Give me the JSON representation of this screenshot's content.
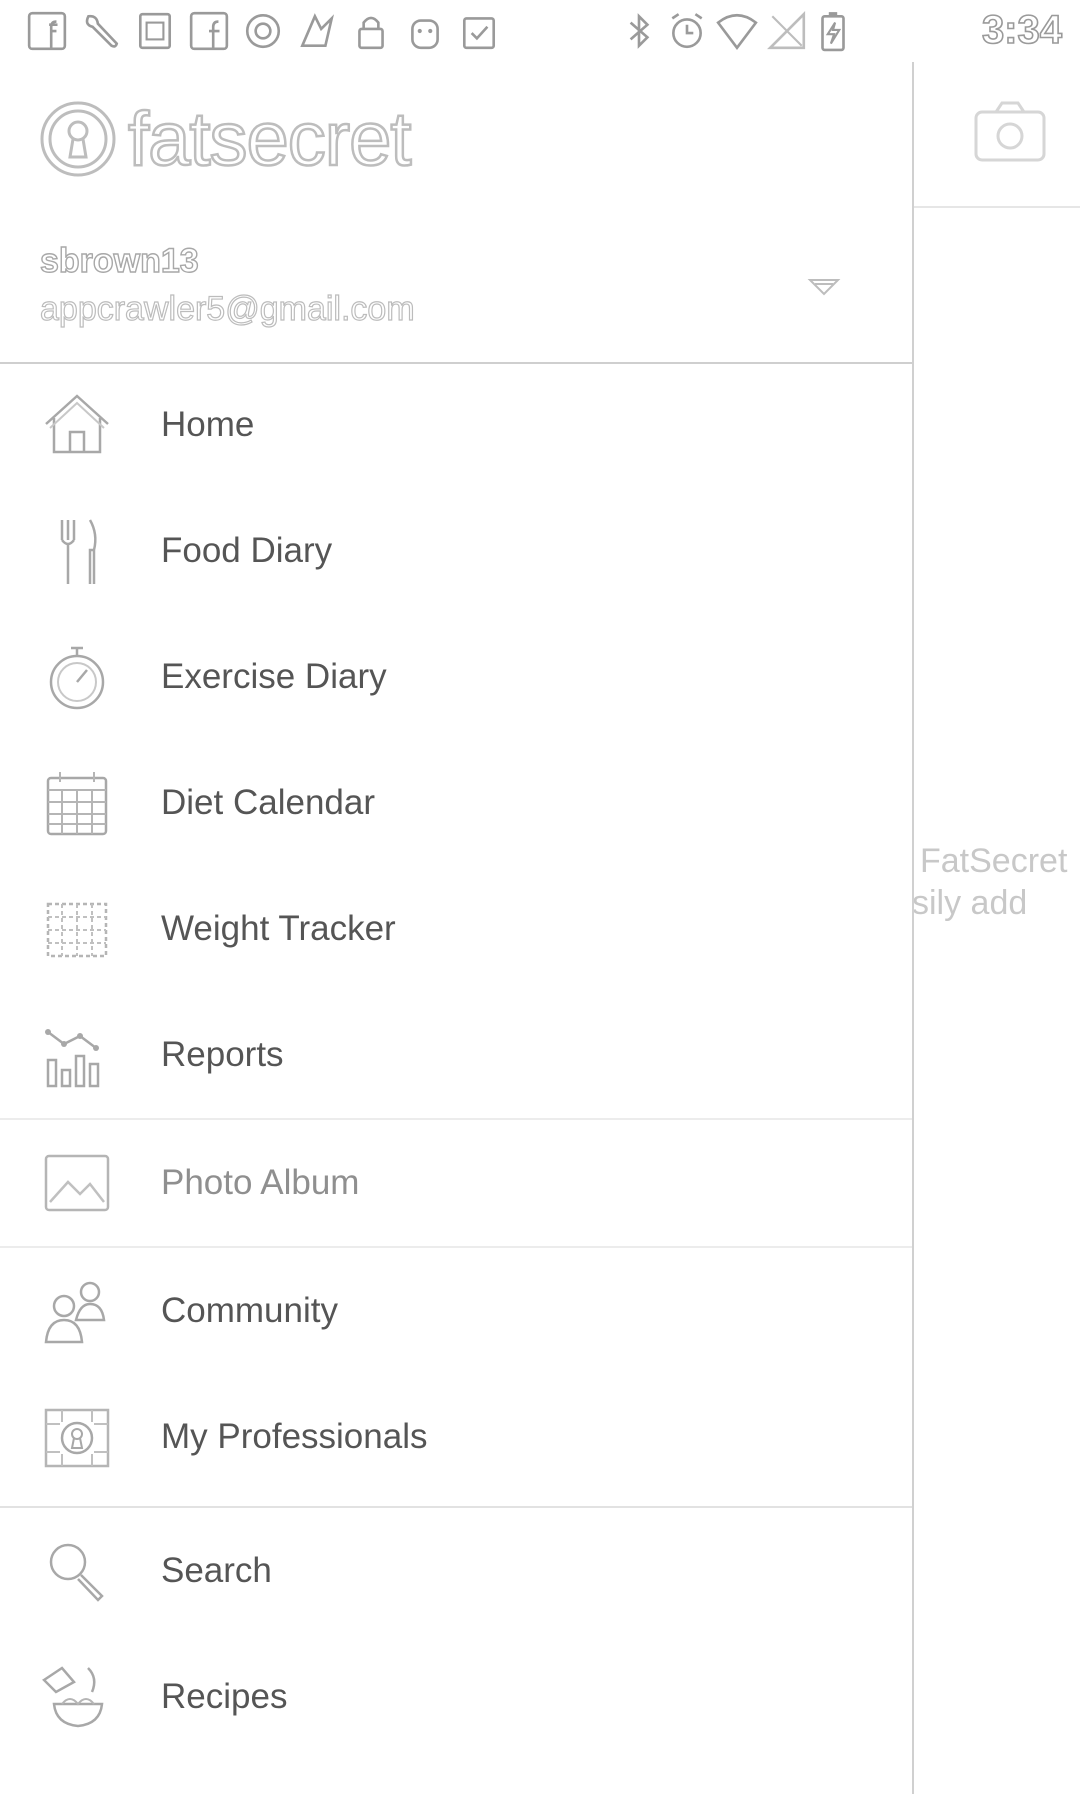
{
  "status_bar": {
    "time": "3:34",
    "left_icons": [
      "facebook-icon",
      "wrench-icon",
      "sim-card-icon",
      "facebook-icon",
      "circle-icon",
      "puzzle-icon",
      "lock-icon",
      "android-icon",
      "clipboard-check-icon"
    ],
    "right_icons": [
      "bluetooth-icon",
      "alarm-icon",
      "wifi-icon",
      "no-signal-icon",
      "battery-charging-icon"
    ]
  },
  "header": {
    "app_name": "fatsecret",
    "username": "sbrown13",
    "email": "appcrawler5@gmail.com"
  },
  "menu": {
    "items": [
      {
        "label": "Home",
        "icon": "home-icon"
      },
      {
        "label": "Food Diary",
        "icon": "fork-knife-icon"
      },
      {
        "label": "Exercise Diary",
        "icon": "stopwatch-icon"
      },
      {
        "label": "Diet Calendar",
        "icon": "calendar-icon"
      },
      {
        "label": "Weight Tracker",
        "icon": "weight-grid-icon"
      },
      {
        "label": "Reports",
        "icon": "bar-chart-icon"
      },
      {
        "label": "Photo Album",
        "icon": "photo-icon"
      },
      {
        "label": "Community",
        "icon": "people-icon"
      },
      {
        "label": "My Professionals",
        "icon": "professional-icon"
      },
      {
        "label": "Search",
        "icon": "search-icon"
      },
      {
        "label": "Recipes",
        "icon": "recipe-bowl-icon"
      }
    ]
  },
  "background": {
    "text_line1": "FatSecret",
    "text_line2": "sily add"
  }
}
